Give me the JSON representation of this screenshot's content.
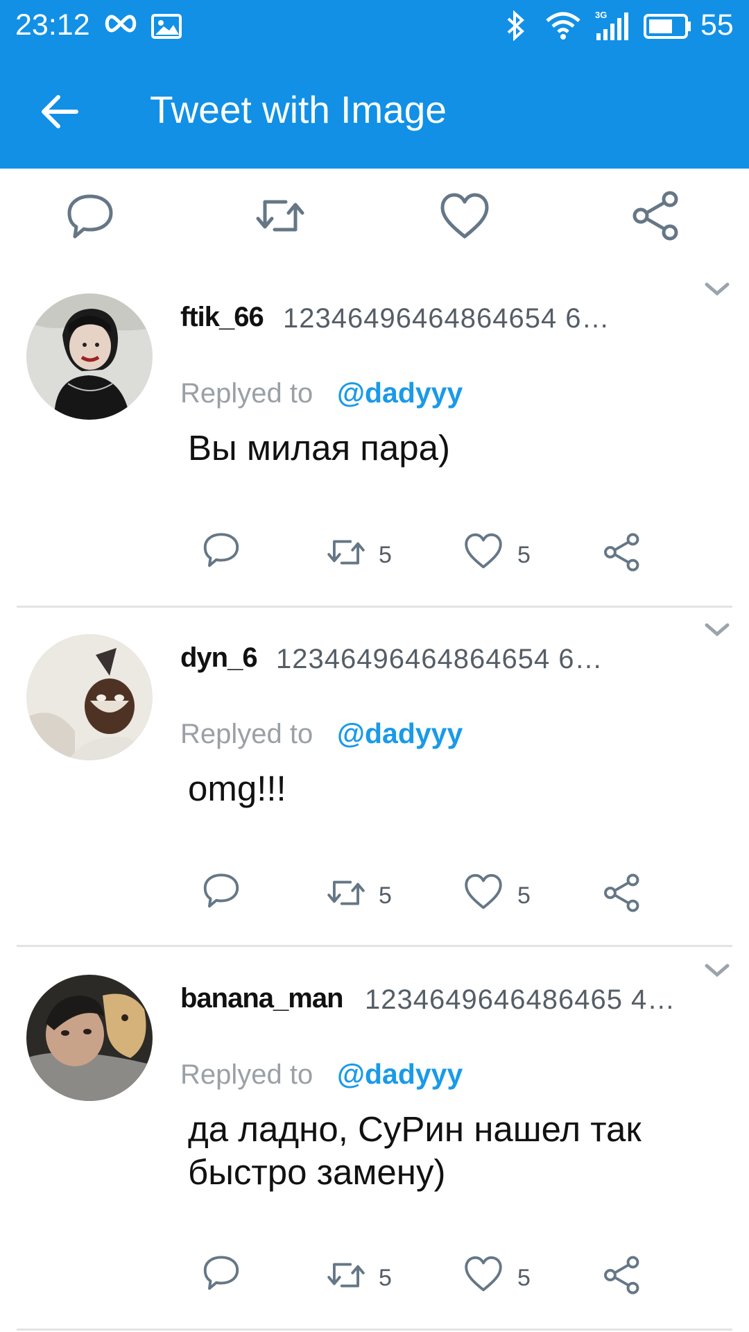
{
  "status_bar": {
    "time": "23:12",
    "network": "3G",
    "battery": "55"
  },
  "app_bar": {
    "title": "Tweet with Image"
  },
  "colors": {
    "primary": "#1190e6",
    "mention": "#1a9ae8",
    "icon": "#657786"
  },
  "main_actions": [
    "reply-icon",
    "retweet-icon",
    "heart-icon",
    "share-icon"
  ],
  "replies": [
    {
      "username": "ftik_66",
      "handle": "12346496464864654 6…",
      "replied_label": "Replyed to",
      "replied_to": "@dadyyy",
      "text": "Вы милая пара)",
      "retweets": "5",
      "likes": "5"
    },
    {
      "username": "dyn_6",
      "handle": "12346496464864654 6…",
      "replied_label": "Replyed to",
      "replied_to": "@dadyyy",
      "text": "omg!!!",
      "retweets": "5",
      "likes": "5"
    },
    {
      "username": "banana_man",
      "handle": "1234649646486465 4…",
      "replied_label": "Replyed to",
      "replied_to": "@dadyyy",
      "text": "да ладно, СуРин нашел так быстро замену)",
      "retweets": "5",
      "likes": "5"
    }
  ]
}
